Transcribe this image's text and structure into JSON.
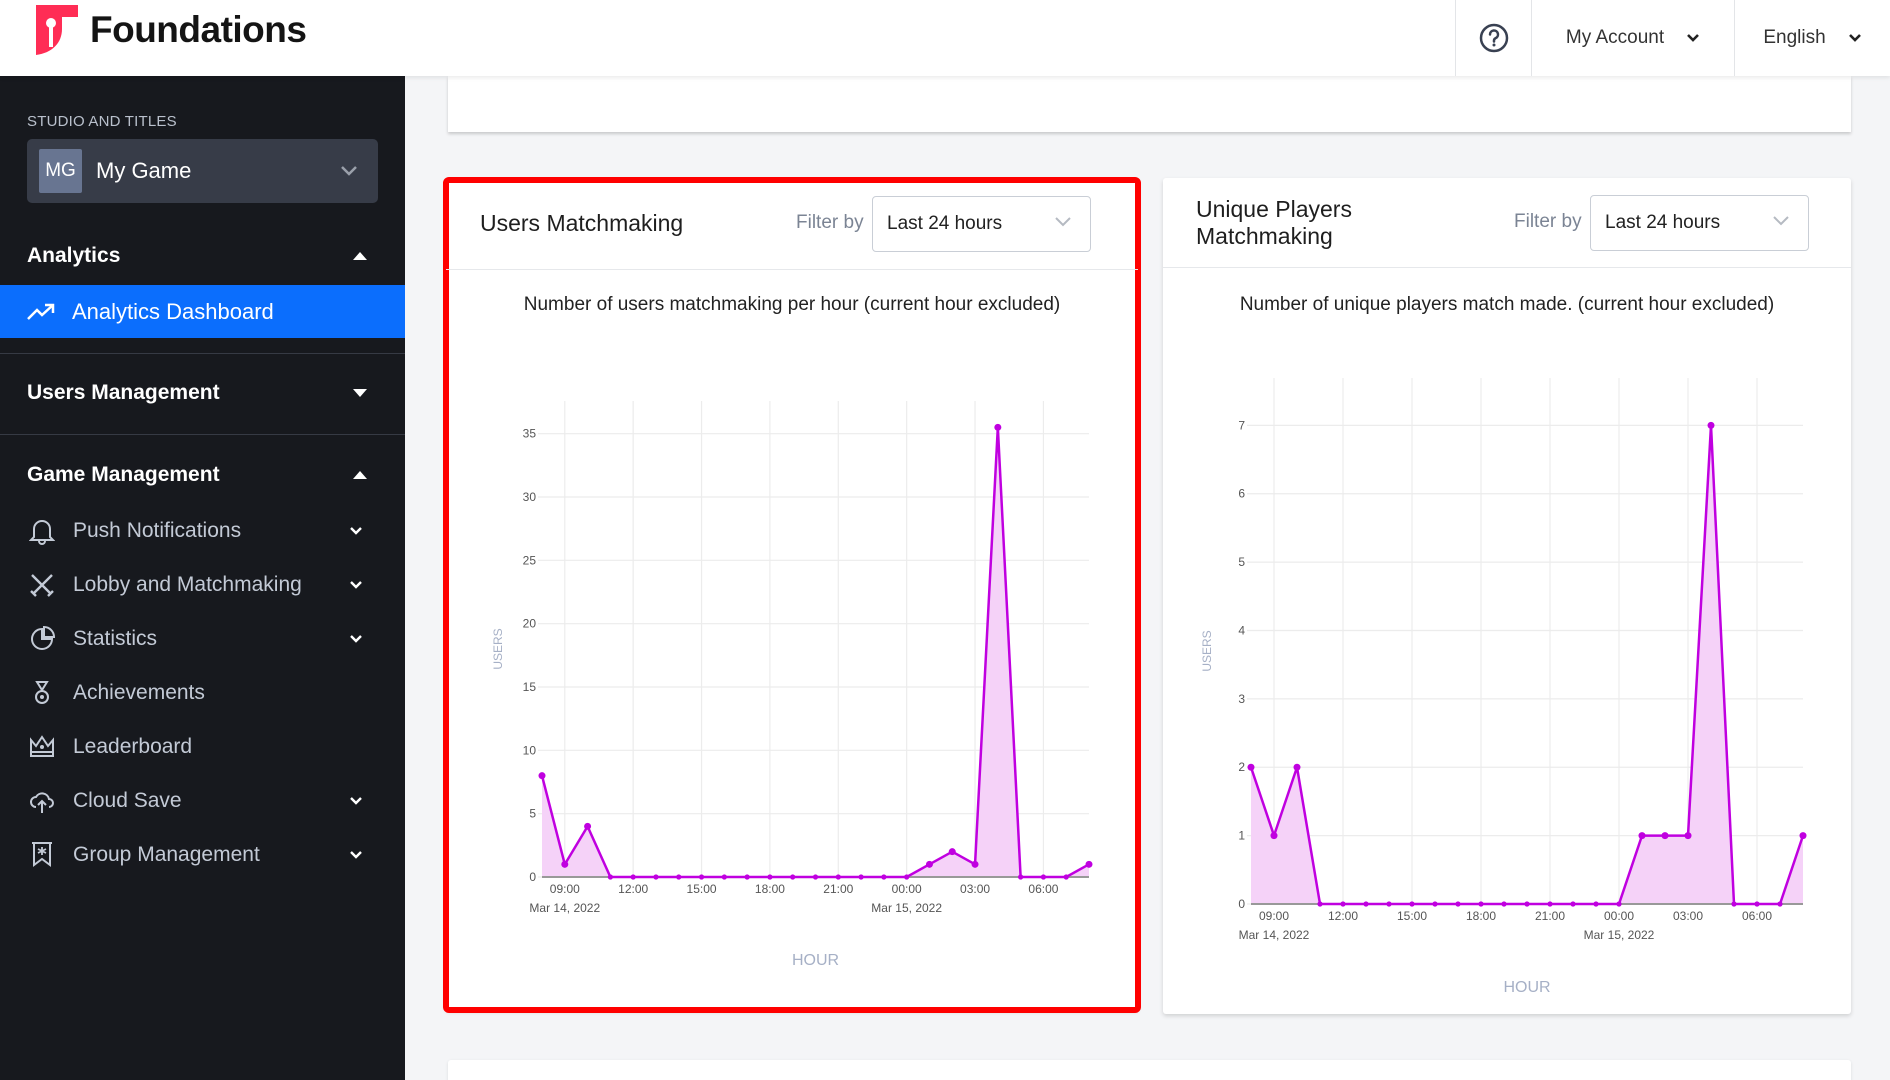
{
  "app": {
    "brand": "Foundations",
    "brand_color": "#ff2d55",
    "accent_color": "#0b6efd"
  },
  "topbar": {
    "help_icon": "help-circle-icon",
    "account_label": "My Account",
    "language_label": "English"
  },
  "sidebar": {
    "studio_label": "STUDIO AND TITLES",
    "game": {
      "initials": "MG",
      "name": "My Game"
    },
    "sections": [
      {
        "label": "Analytics",
        "expanded": true
      },
      {
        "label": "Users Management",
        "expanded": false
      },
      {
        "label": "Game Management",
        "expanded": true
      }
    ],
    "active_item": {
      "label": "Analytics Dashboard",
      "icon": "trending-up-icon"
    },
    "game_items": [
      {
        "label": "Push Notifications",
        "icon": "bell-icon",
        "has_children": true
      },
      {
        "label": "Lobby and Matchmaking",
        "icon": "crossed-swords-icon",
        "has_children": true
      },
      {
        "label": "Statistics",
        "icon": "pie-chart-icon",
        "has_children": true
      },
      {
        "label": "Achievements",
        "icon": "medal-icon",
        "has_children": false
      },
      {
        "label": "Leaderboard",
        "icon": "crown-icon",
        "has_children": false
      },
      {
        "label": "Cloud Save",
        "icon": "cloud-upload-icon",
        "has_children": true
      },
      {
        "label": "Group Management",
        "icon": "group-banner-icon",
        "has_children": true
      }
    ]
  },
  "cards": [
    {
      "title": "Users Matchmaking",
      "filter_label": "Filter by",
      "filter_value": "Last 24 hours",
      "subtitle": "Number of users matchmaking per hour (current hour excluded)"
    },
    {
      "title_line1": "Unique Players",
      "title_line2": "Matchmaking",
      "filter_label": "Filter by",
      "filter_value": "Last 24 hours",
      "subtitle": "Number of unique players match made. (current hour excluded)"
    }
  ],
  "chart_data": [
    {
      "type": "area",
      "title": "Number of users matchmaking per hour (current hour excluded)",
      "xlabel": "HOUR",
      "ylabel": "USERS",
      "x": [
        "Mar 14 08:00",
        "09:00",
        "10:00",
        "11:00",
        "12:00",
        "13:00",
        "14:00",
        "15:00",
        "16:00",
        "17:00",
        "18:00",
        "19:00",
        "20:00",
        "21:00",
        "22:00",
        "23:00",
        "Mar 15 00:00",
        "01:00",
        "02:00",
        "03:00",
        "04:00",
        "05:00",
        "06:00",
        "07:00",
        "08:00"
      ],
      "series": [
        {
          "name": "Users",
          "color": "#c000e0",
          "fill": "#f5d2f8",
          "values": [
            8,
            1,
            4,
            0,
            0,
            0,
            0,
            0,
            0,
            0,
            0,
            0,
            0,
            0,
            0,
            0,
            0,
            1,
            2,
            1,
            35.5,
            0,
            0,
            0,
            1
          ]
        }
      ],
      "ylim": [
        0,
        36
      ],
      "yticks": [
        "0",
        "5",
        "10",
        "15",
        "20",
        "25",
        "30",
        "35"
      ],
      "xticks": [
        "09:00",
        "12:00",
        "15:00",
        "18:00",
        "21:00",
        "00:00",
        "03:00",
        "06:00"
      ],
      "date_labels": [
        {
          "at": "09:00",
          "text": "Mar 14, 2022"
        },
        {
          "at": "00:00",
          "text": "Mar 15, 2022"
        }
      ],
      "grid": true
    },
    {
      "type": "area",
      "title": "Number of unique players match made. (current hour excluded)",
      "xlabel": "HOUR",
      "ylabel": "USERS",
      "x": [
        "Mar 14 08:00",
        "09:00",
        "10:00",
        "11:00",
        "12:00",
        "13:00",
        "14:00",
        "15:00",
        "16:00",
        "17:00",
        "18:00",
        "19:00",
        "20:00",
        "21:00",
        "22:00",
        "23:00",
        "Mar 15 00:00",
        "01:00",
        "02:00",
        "03:00",
        "04:00",
        "05:00",
        "06:00",
        "07:00",
        "08:00"
      ],
      "series": [
        {
          "name": "Unique players",
          "color": "#c000e0",
          "fill": "#f5d2f8",
          "values": [
            2,
            1,
            2,
            0,
            0,
            0,
            0,
            0,
            0,
            0,
            0,
            0,
            0,
            0,
            0,
            0,
            0,
            1,
            1,
            1,
            7,
            0,
            0,
            0,
            1
          ]
        }
      ],
      "ylim": [
        0,
        7.4
      ],
      "yticks": [
        "0",
        "1",
        "2",
        "3",
        "4",
        "5",
        "6",
        "7"
      ],
      "xticks": [
        "09:00",
        "12:00",
        "15:00",
        "18:00",
        "21:00",
        "00:00",
        "03:00",
        "06:00"
      ],
      "date_labels": [
        {
          "at": "09:00",
          "text": "Mar 14, 2022"
        },
        {
          "at": "00:00",
          "text": "Mar 15, 2022"
        }
      ],
      "grid": true
    }
  ]
}
